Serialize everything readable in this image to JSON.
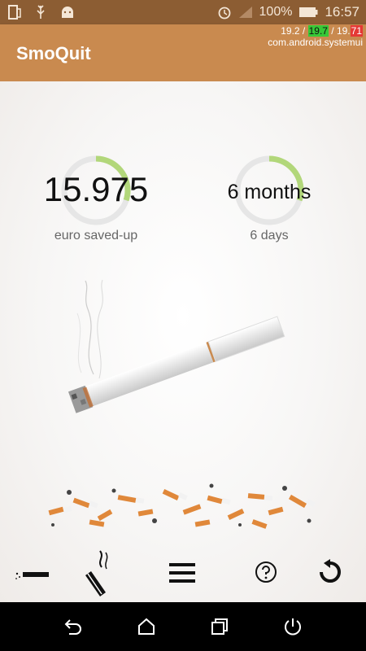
{
  "status_bar": {
    "battery_percent": "100%",
    "time": "16:57",
    "icons": [
      "screen-icon",
      "usb-icon",
      "android-icon",
      "alarm-icon",
      "signal-icon",
      "battery-icon"
    ]
  },
  "overlay": {
    "part1": "19.2 / ",
    "part2": "19.7",
    "part3": " / 19.",
    "part4": "71",
    "process": "com.android.systemui"
  },
  "app": {
    "title": "SmoQuit"
  },
  "stats": {
    "money": {
      "value": "15.975",
      "label": "euro saved-up",
      "ring_fraction": 0.3
    },
    "time": {
      "value": "6 months",
      "label": "6 days",
      "ring_fraction": 0.3
    }
  },
  "colors": {
    "status_bar": "#8c5d33",
    "app_bar": "#c98a4f",
    "ring": "#b2d77a",
    "ring_track": "#e6e6e6"
  },
  "bottom_bar": {
    "icons": [
      "cigarette-icon",
      "smoke-icon",
      "menu-icon",
      "help-icon",
      "reset-icon"
    ]
  },
  "nav_bar": {
    "icons": [
      "back-icon",
      "home-icon",
      "recents-icon",
      "power-icon"
    ]
  }
}
